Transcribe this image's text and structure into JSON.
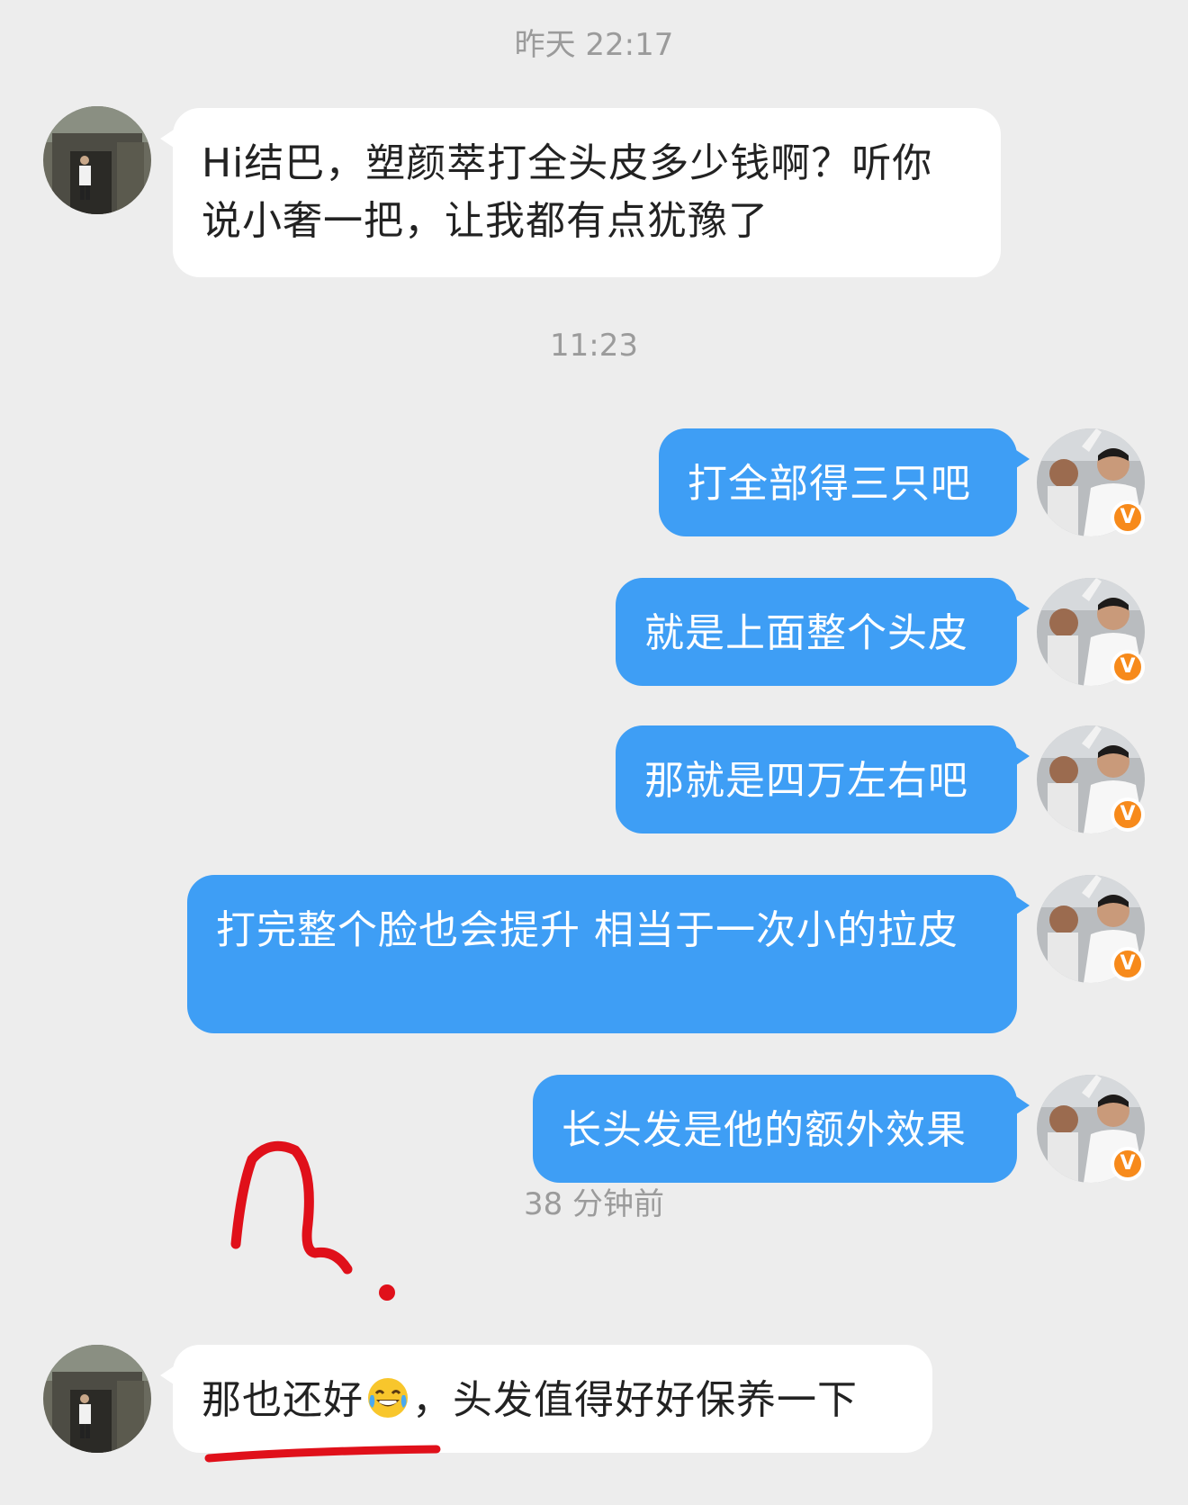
{
  "timestamps": [
    "昨天 22:17",
    "11:23",
    "38 分钟前"
  ],
  "messages": [
    {
      "side": "in",
      "text": "Hi结巴，塑颜萃打全头皮多少钱啊？听你说小奢一把，让我都有点犹豫了"
    },
    {
      "side": "out",
      "text": "打全部得三只吧"
    },
    {
      "side": "out",
      "text": "就是上面整个头皮"
    },
    {
      "side": "out",
      "text": "那就是四万左右吧"
    },
    {
      "side": "out",
      "text": "打完整个脸也会提升 相当于一次小的拉皮"
    },
    {
      "side": "out",
      "text": "长头发是他的额外效果"
    },
    {
      "side": "in",
      "text_before_emoji": "那也还好",
      "emoji": "tears-of-joy-emoji",
      "text_after_emoji": "，头发值得好好保养一下"
    }
  ],
  "verified_badge": "V",
  "colors": {
    "background": "#ededed",
    "incoming_bubble": "#ffffff",
    "outgoing_bubble": "#3e9ef5",
    "timestamp": "#9b9b9b",
    "annotation": "#e0101a"
  }
}
